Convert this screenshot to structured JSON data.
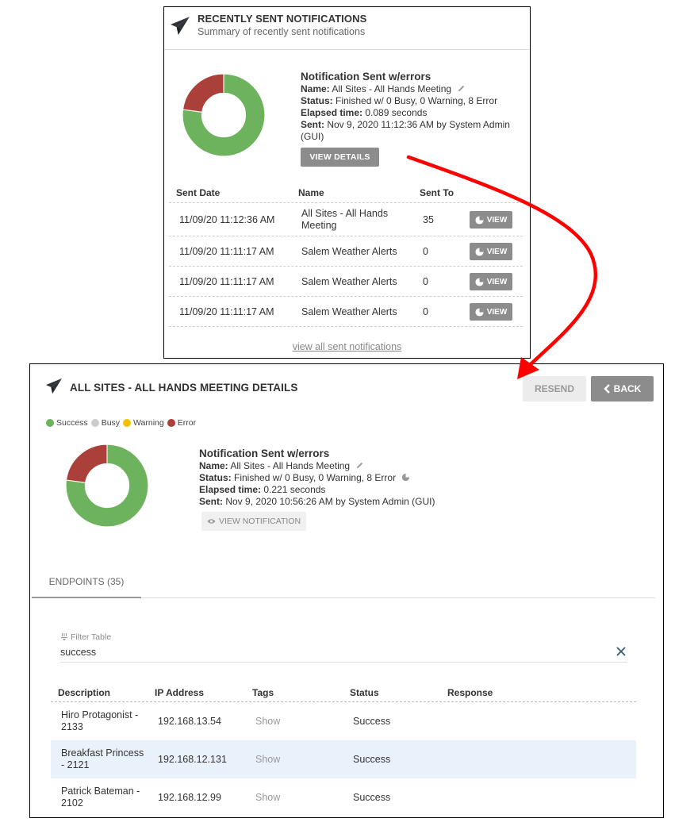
{
  "colors": {
    "success": "#6db35e",
    "busy": "#cccccc",
    "warning": "#f5c000",
    "error": "#ab3f39",
    "button_gray": "#8c8c8c",
    "annotation_arrow": "#ff0000",
    "highlight_row": "#e9f2fb"
  },
  "recent_panel": {
    "icon": "paper-plane-icon",
    "title": "RECENTLY SENT NOTIFICATIONS",
    "subtitle": "Summary of recently sent notifications",
    "summary": {
      "heading": "Notification Sent w/errors",
      "name_label": "Name:",
      "name_value": "All Sites - All Hands Meeting",
      "status_label": "Status:",
      "status_value": "Finished w/ 0 Busy, 0 Warning, 8 Error",
      "elapsed_label": "Elapsed time:",
      "elapsed_value": "0.089 seconds",
      "sent_label": "Sent:",
      "sent_value": "Nov 9, 2020 11:12:36 AM by System Admin (GUI)"
    },
    "donut": {
      "success": 27,
      "busy": 0,
      "warning": 0,
      "error": 8
    },
    "view_details_label": "VIEW DETAILS",
    "table": {
      "headers": [
        "Sent Date",
        "Name",
        "Sent To",
        ""
      ],
      "rows": [
        {
          "date": "11/09/20 11:12:36 AM",
          "name": "All Sites - All Hands Meeting",
          "sent_to": "35",
          "action": "VIEW"
        },
        {
          "date": "11/09/20 11:11:17 AM",
          "name": "Salem Weather Alerts",
          "sent_to": "0",
          "action": "VIEW"
        },
        {
          "date": "11/09/20 11:11:17 AM",
          "name": "Salem Weather Alerts",
          "sent_to": "0",
          "action": "VIEW"
        },
        {
          "date": "11/09/20 11:11:17 AM",
          "name": "Salem Weather Alerts",
          "sent_to": "0",
          "action": "VIEW"
        }
      ]
    },
    "view_all_label": "view all sent notifications"
  },
  "details_panel": {
    "icon": "paper-plane-icon",
    "title": "ALL SITES - ALL HANDS MEETING DETAILS",
    "resend_label": "RESEND",
    "back_label": "BACK",
    "legend": [
      {
        "label": "Success",
        "color": "#6db35e"
      },
      {
        "label": "Busy",
        "color": "#cccccc"
      },
      {
        "label": "Warning",
        "color": "#f5c000"
      },
      {
        "label": "Error",
        "color": "#ab3f39"
      }
    ],
    "summary": {
      "heading": "Notification Sent w/errors",
      "name_label": "Name:",
      "name_value": "All Sites - All Hands Meeting",
      "status_label": "Status:",
      "status_value": "Finished w/ 0 Busy, 0 Warning, 8 Error",
      "elapsed_label": "Elapsed time:",
      "elapsed_value": "0.221 seconds",
      "sent_label": "Sent:",
      "sent_value": "Nov 9, 2020 10:56:26 AM by System Admin (GUI)"
    },
    "donut": {
      "success": 27,
      "busy": 0,
      "warning": 0,
      "error": 8
    },
    "view_notification_label": "VIEW NOTIFICATION",
    "tabs": [
      {
        "label": "ENDPOINTS (35)",
        "active": true
      }
    ],
    "filter": {
      "label": "Filter Table",
      "value": "success"
    },
    "table": {
      "headers": [
        "Description",
        "IP Address",
        "Tags",
        "Status",
        "Response"
      ],
      "rows": [
        {
          "description": "Hiro Protagonist - 2133",
          "ip": "192.168.13.54",
          "tags": "Show",
          "status": "Success",
          "response": ""
        },
        {
          "description": "Breakfast Princess - 2121",
          "ip": "192.168.12.131",
          "tags": "Show",
          "status": "Success",
          "response": ""
        },
        {
          "description": "Patrick Bateman - 2102",
          "ip": "192.168.12.99",
          "tags": "Show",
          "status": "Success",
          "response": ""
        }
      ]
    }
  }
}
